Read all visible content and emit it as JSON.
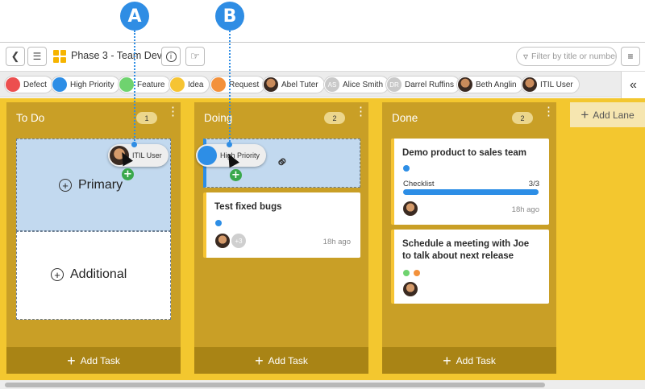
{
  "callouts": [
    {
      "label": "A"
    },
    {
      "label": "B"
    }
  ],
  "toolbar": {
    "board_title": "Phase 3 - Team Dev",
    "filter_placeholder": "Filter by title or number"
  },
  "tags": [
    {
      "label": "Defect",
      "color": "#ec4f4f"
    },
    {
      "label": "High Priority",
      "color": "#2d8ee6"
    },
    {
      "label": "Feature",
      "color": "#6fd36f"
    },
    {
      "label": "Idea",
      "color": "#f6c433"
    },
    {
      "label": "Request",
      "color": "#f3913b"
    }
  ],
  "users": [
    {
      "label": "Abel Tuter"
    },
    {
      "label": "Alice Smith",
      "initials": "AS"
    },
    {
      "label": "Darrel Ruffins",
      "initials": "DR"
    },
    {
      "label": "Beth Anglin"
    },
    {
      "label": "ITIL User"
    }
  ],
  "lanes": [
    {
      "title": "To Do",
      "count": "1",
      "add_task": "Add Task",
      "drop_primary": "Primary",
      "drop_additional": "Additional",
      "drag_chip": "ITIL User"
    },
    {
      "title": "Doing",
      "count": "2",
      "add_task": "Add Task",
      "drag_chip": "High Priority",
      "cards": [
        {
          "title": "Test fixed bugs",
          "time": "18h ago",
          "extra": "+3"
        }
      ]
    },
    {
      "title": "Done",
      "count": "2",
      "add_task": "Add Task",
      "cards": [
        {
          "title": "Demo product to sales team",
          "checklist_label": "Checklist",
          "checklist_count": "3/3",
          "checklist_progress": 1.0,
          "time": "18h ago"
        },
        {
          "title_line1": "Schedule a meeting with Joe",
          "title_line2": "to talk about next release"
        }
      ]
    }
  ],
  "add_lane": "Add Lane",
  "colors": {
    "accent": "#2f8de4",
    "lane": "#c99f26",
    "board_bg": "#f3c72f",
    "card_border": "#f6c433"
  }
}
